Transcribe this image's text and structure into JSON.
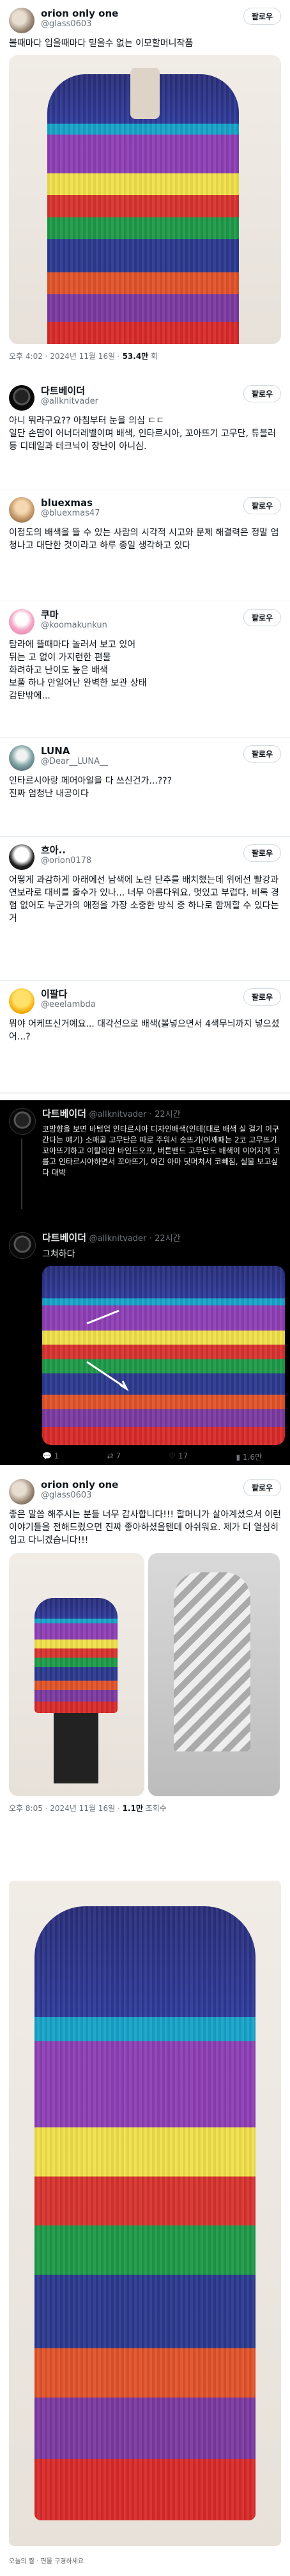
{
  "post1": {
    "name": "orion only one",
    "handle": "@glass0603",
    "follow": "팔로우",
    "text": "볼때마다 입을때마다 믿을수 없는 이모할머니작품",
    "timestamp": "오후 4:02 · 2024년 11월 16일 · ",
    "views": "53.4만",
    "views_suffix": " 회"
  },
  "thread": {
    "c1": {
      "name": "다트베이더",
      "handle": "@allknitvader",
      "follow": "팔로우",
      "text": "아니 뭐라구요?? 아침부터 눈을 의심 ㄷㄷ\n일단 손땀이 어너더레벨이며 배색, 인타르시아, 꼬아뜨기 고무단, 튜블러 등 디테일과 테크닉이 장난이 아니심."
    },
    "c2": {
      "name": "bluexmas",
      "handle": "@bluexmas47",
      "follow": "팔로우",
      "text": "이정도의 배색을 뜰 수 있는 사람의 시각적 시고와 문제 해결력은 정말 엄청나고 대단한 것이라고 하루 종일 생각하고 있다"
    },
    "c3": {
      "name": "쿠마",
      "handle": "@koomakunkun",
      "follow": "팔로우",
      "text": "탐라에 뜰때마다 놀러서 보고 있어\n뒤는 고 없이 가지런한 편물\n화려하고 난이도 높은 배색\n보풀 하나 안일어난 완벽한 보관 상태\n감탄밖에..."
    },
    "c4": {
      "name": "LUNA",
      "handle": "@Dear__LUNA__",
      "follow": "팔로우",
      "text": "인타르시아랑 페어아일을 다 쓰신건가...???\n진짜 엄청난 내공이다"
    },
    "c5": {
      "name": "흐아..",
      "handle": "@orion0178",
      "follow": "팔로우",
      "text": "어떻게 과감하게 아래에선 남색에 노란 단추를 배치했는데 위에선 빨강과 연보라로 대비를 줄수가 있나... 너무 아름다워요. 멋있고 부럽다. 비록 경험 없어도 누군가의 애정을 가장 소중한 방식 중 하나로 함께할 수 있다는 거"
    },
    "c6": {
      "name": "이팔다",
      "handle": "@eeelambda",
      "follow": "팔로우",
      "text": "뭐야 어케뜨신거예요... 대각선으로 배색(볼넣으면서 4색무늬까지 넣으셨어...?"
    }
  },
  "dark_thread": {
    "t1": {
      "name": "다트베이더",
      "handle": "@allknitvader",
      "time": "· 22시간",
      "text": "코방향을 보면 바텀업 인타르시아 디자인배색(인테(대로 배색 실 걸기 이구 간다는 얘기) 소매골 고무단은 따로 주워서 솟뜨기(어깨패는 2코 고무뜨기 꼬아뜨기하고 이탈리안 바인드오프, 버튼밴드 고무단도 배색이 이어지게 코를고 인타르시아하면서 꼬아뜨기, 여긴 아마 덧머쳐서 코빼짐, 실물 보고싶다 대박"
    },
    "t2": {
      "name": "다트베이더",
      "handle": "@allknitvader",
      "time": "· 22시간",
      "text": "그쳐하다"
    },
    "engagement": {
      "replies": "1",
      "retweets": "7",
      "likes": "17",
      "views": "1.6만"
    }
  },
  "post2": {
    "name": "orion only one",
    "handle": "@glass0603",
    "follow": "팔로우",
    "text": "좋은 말씀 해주시는 분들 너무 감사합니다!!! 할머니가 살아계셨으서 이런 이야기들을 전해드렸으면 진짜 좋아하셨을텐데 아쉬워요. 제가 더 열심히 입고 다니겠습니다!!!",
    "timestamp": "오후 8:05 · 2024년 11월 16일 · ",
    "views": "1.1만",
    "views_suffix": " 조회수"
  },
  "footer": {
    "caption": "오늘의 짤 · 편물 구경하세요"
  },
  "icons": {
    "reply": "reply-icon",
    "retweet": "retweet-icon",
    "like": "heart-icon",
    "views": "views-icon"
  },
  "colors": {
    "dark_bg": "#000000",
    "light_bg": "#ffffff",
    "accent": "#1d9bf0"
  }
}
